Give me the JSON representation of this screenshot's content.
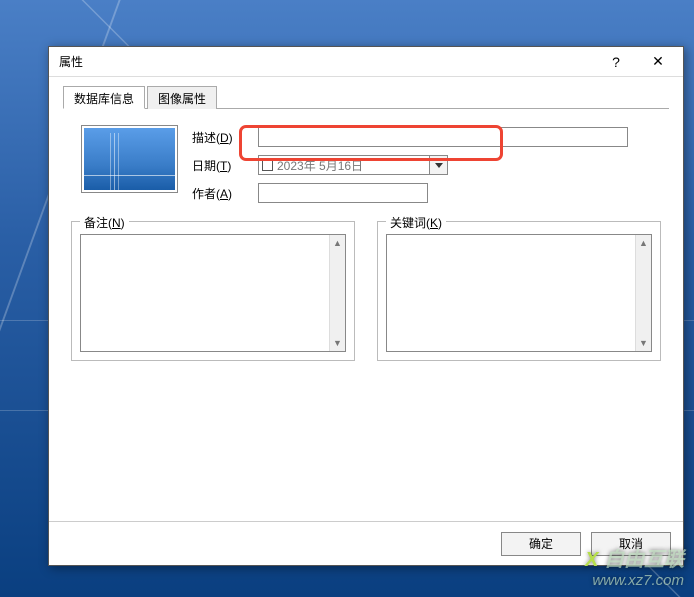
{
  "window": {
    "title": "属性",
    "help": "?",
    "close": "✕"
  },
  "tabs": {
    "database": "数据库信息",
    "image": "图像属性"
  },
  "fields": {
    "desc_label_pre": "描述(",
    "desc_key": "D",
    "desc_label_post": ")",
    "desc_value": "",
    "date_label_pre": "日期(",
    "date_key": "T",
    "date_label_post": ")",
    "date_value": "2023年 5月16日",
    "author_label_pre": "作者(",
    "author_key": "A",
    "author_label_post": ")",
    "author_value": ""
  },
  "groups": {
    "notes_label_pre": "备注(",
    "notes_key": "N",
    "notes_label_post": ")",
    "notes_value": "",
    "keywords_label_pre": "关键词(",
    "keywords_key": "K",
    "keywords_label_post": ")",
    "keywords_value": ""
  },
  "buttons": {
    "ok": "确定",
    "cancel": "取消"
  },
  "watermark": {
    "brand": "自由互联",
    "url": "www.xz7.com"
  }
}
